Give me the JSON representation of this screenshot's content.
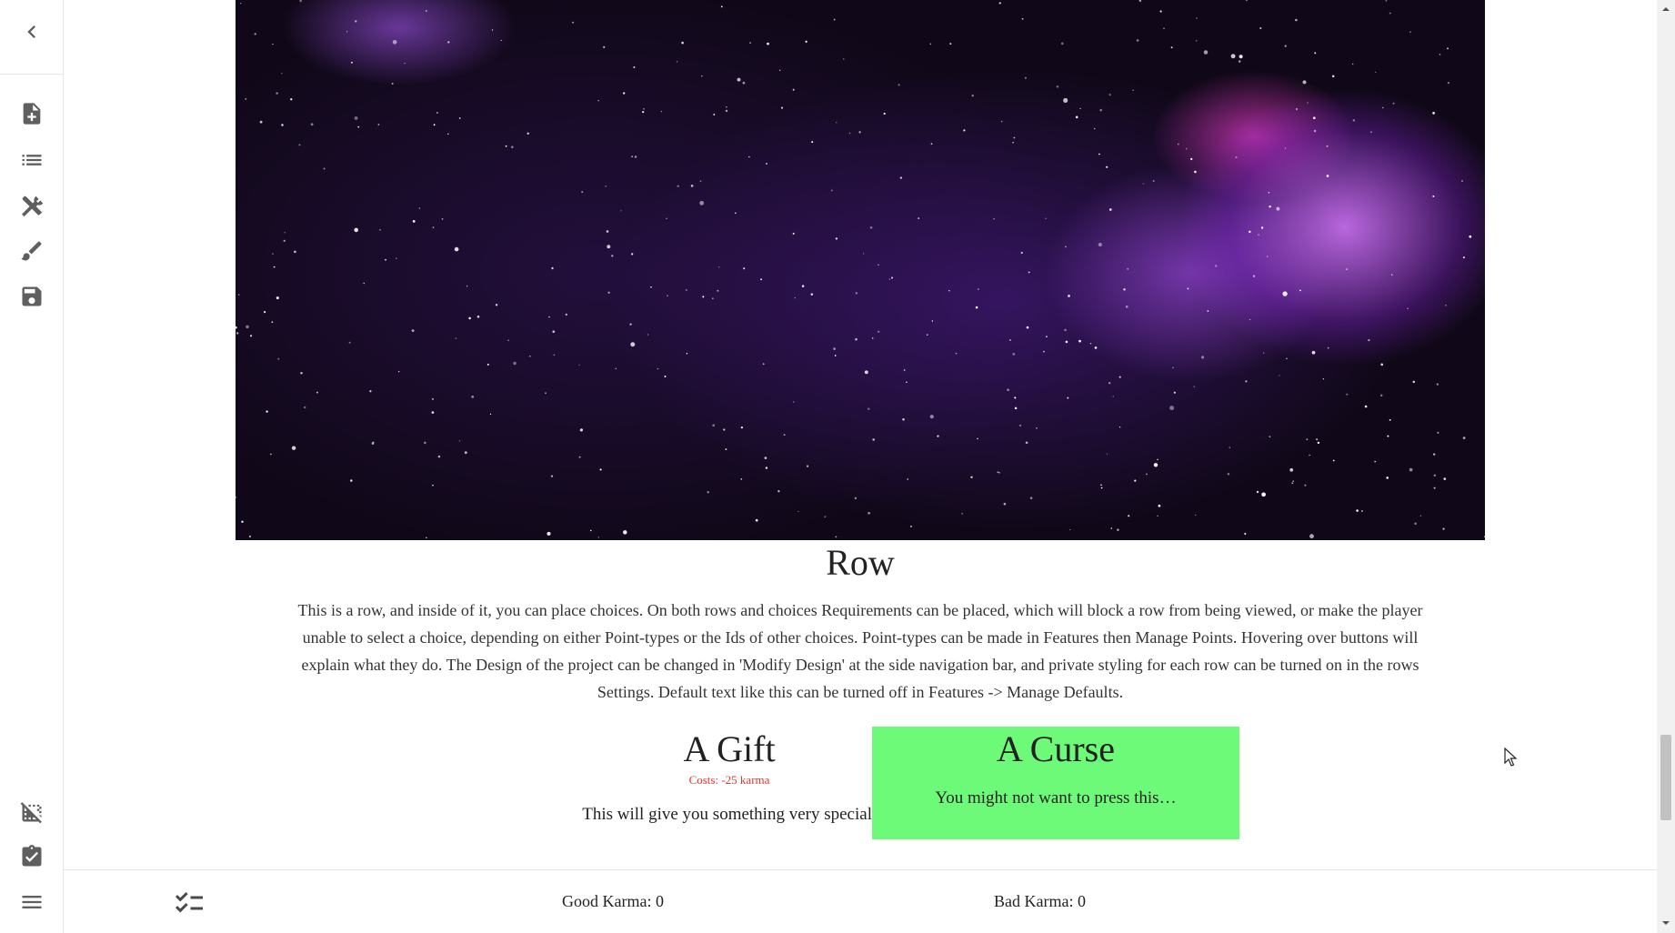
{
  "sidebar": {
    "icons": [
      {
        "name": "collapse-chevron-icon"
      },
      {
        "name": "new-project-icon"
      },
      {
        "name": "rows-list-icon"
      },
      {
        "name": "features-tools-icon"
      },
      {
        "name": "modify-design-icon"
      },
      {
        "name": "save-icon"
      },
      {
        "name": "hide-images-icon"
      },
      {
        "name": "clipboard-icon"
      },
      {
        "name": "menu-icon"
      }
    ]
  },
  "row": {
    "title": "Row",
    "text": "This is a row, and inside of it, you can place choices. On both rows and choices Requirements can be placed, which will block a row from being viewed, or make the player unable to select a choice, depending on either Point-types or the Ids of other choices. Point-types can be made in Features then Manage Points. Hovering over buttons will explain what they do. The Design of the project can be changed in 'Modify Design' at the side navigation bar, and private styling for each row can be turned on in the rows Settings. Default text like this can be turned off in Features -> Manage Defaults."
  },
  "choices": [
    {
      "title": "A Gift",
      "cost": "Costs: -25  karma",
      "description": "This will give you something very special.",
      "selected": false
    },
    {
      "title": "A Curse",
      "description": "You might not want to press this…",
      "selected": true,
      "selected_color": "#6dfa78"
    }
  ],
  "points_bar": {
    "good_karma": "Good Karma: 0",
    "bad_karma": "Bad Karma: 0"
  },
  "colors": {
    "cost_text": "#e8342a",
    "selected_choice": "#6dfa78",
    "icon": "#5f5f5f"
  }
}
